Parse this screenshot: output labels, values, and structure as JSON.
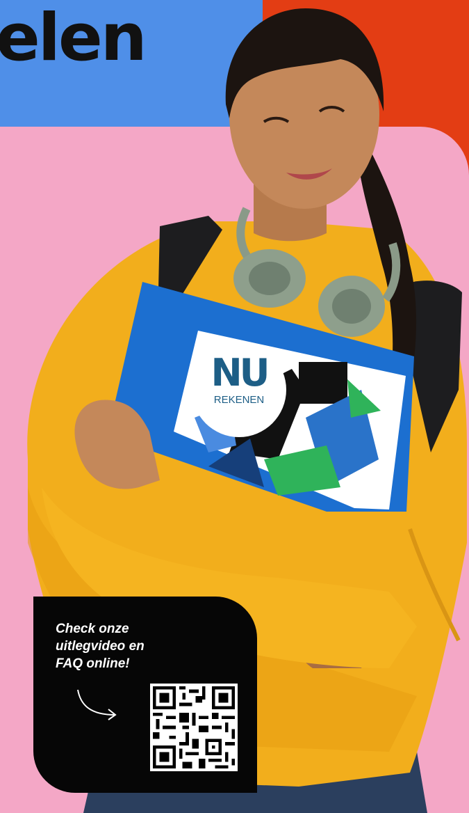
{
  "headline": "elen",
  "book": {
    "brand_mark": "NU",
    "subject": "REKENEN"
  },
  "qr_card": {
    "text_lines": [
      "Check onze",
      "uitlegvideo en",
      "FAQ online!"
    ]
  },
  "colors": {
    "blue": "#4f8fe8",
    "orange": "#e33d14",
    "pink": "#f4a7c6",
    "black": "#060606",
    "sweater": "#f2ae1c",
    "book_blue": "#1c6fd0"
  },
  "icons": [
    "curved-arrow-icon",
    "qr-code-icon"
  ]
}
